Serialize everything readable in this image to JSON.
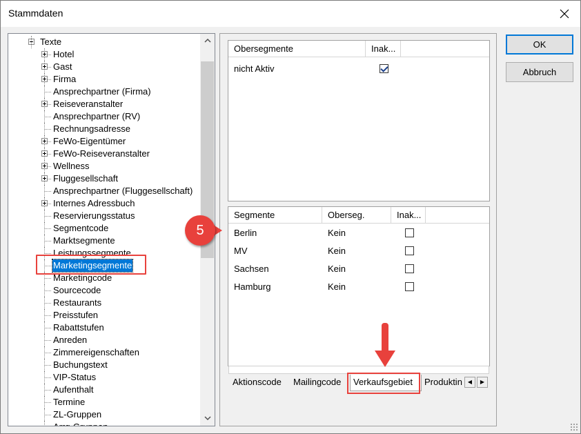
{
  "window": {
    "title": "Stammdaten",
    "close_glyph": "✕"
  },
  "tree": {
    "root_label": "Texte",
    "items": [
      {
        "label": "Hotel",
        "expandable": true
      },
      {
        "label": "Gast",
        "expandable": true
      },
      {
        "label": "Firma",
        "expandable": true
      },
      {
        "label": "Ansprechpartner (Firma)",
        "expandable": false
      },
      {
        "label": "Reiseveranstalter",
        "expandable": true
      },
      {
        "label": "Ansprechpartner (RV)",
        "expandable": false
      },
      {
        "label": "Rechnungsadresse",
        "expandable": false
      },
      {
        "label": "FeWo-Eigentümer",
        "expandable": true
      },
      {
        "label": "FeWo-Reiseveranstalter",
        "expandable": true
      },
      {
        "label": "Wellness",
        "expandable": true
      },
      {
        "label": "Fluggesellschaft",
        "expandable": true
      },
      {
        "label": "Ansprechpartner (Fluggesellschaft)",
        "expandable": false
      },
      {
        "label": "Internes Adressbuch",
        "expandable": true
      },
      {
        "label": "Reservierungsstatus",
        "expandable": false
      },
      {
        "label": "Segmentcode",
        "expandable": false
      },
      {
        "label": "Marktsegmente",
        "expandable": false
      },
      {
        "label": "Leistungssegmente",
        "expandable": false
      },
      {
        "label": "Marketingsegmente",
        "expandable": false,
        "selected": true
      },
      {
        "label": "Marketingcode",
        "expandable": false
      },
      {
        "label": "Sourcecode",
        "expandable": false
      },
      {
        "label": "Restaurants",
        "expandable": false
      },
      {
        "label": "Preisstufen",
        "expandable": false
      },
      {
        "label": "Rabattstufen",
        "expandable": false
      },
      {
        "label": "Anreden",
        "expandable": false
      },
      {
        "label": "Zimmereigenschaften",
        "expandable": false
      },
      {
        "label": "Buchungstext",
        "expandable": false
      },
      {
        "label": "VIP-Status",
        "expandable": false
      },
      {
        "label": "Aufenthalt",
        "expandable": false
      },
      {
        "label": "Termine",
        "expandable": false
      },
      {
        "label": "ZL-Gruppen",
        "expandable": false
      },
      {
        "label": "Arrg-Gruppen",
        "expandable": false
      }
    ]
  },
  "obersegmente_grid": {
    "headers": [
      "Obersegmente",
      "Inak..."
    ],
    "rows": [
      {
        "name": "nicht Aktiv",
        "inaktiv": true
      }
    ]
  },
  "segmente_grid": {
    "headers": [
      "Segmente",
      "Oberseg.",
      "Inak..."
    ],
    "rows": [
      {
        "name": "Berlin",
        "oberseg": "Kein",
        "inaktiv": false
      },
      {
        "name": "MV",
        "oberseg": "Kein",
        "inaktiv": false
      },
      {
        "name": "Sachsen",
        "oberseg": "Kein",
        "inaktiv": false
      },
      {
        "name": "Hamburg",
        "oberseg": "Kein",
        "inaktiv": false
      }
    ]
  },
  "tabs": {
    "items": [
      "Aktionscode",
      "Mailingcode",
      "Verkaufsgebiet",
      "Produktin"
    ],
    "active": "Verkaufsgebiet",
    "prev_glyph": "◀",
    "next_glyph": "▶"
  },
  "buttons": {
    "ok": "OK",
    "cancel": "Abbruch"
  },
  "annotation": {
    "step_number": "5",
    "accent_color": "#e8413c"
  },
  "colors": {
    "selection": "#0078d7",
    "window_bg": "#f0f0f0"
  }
}
